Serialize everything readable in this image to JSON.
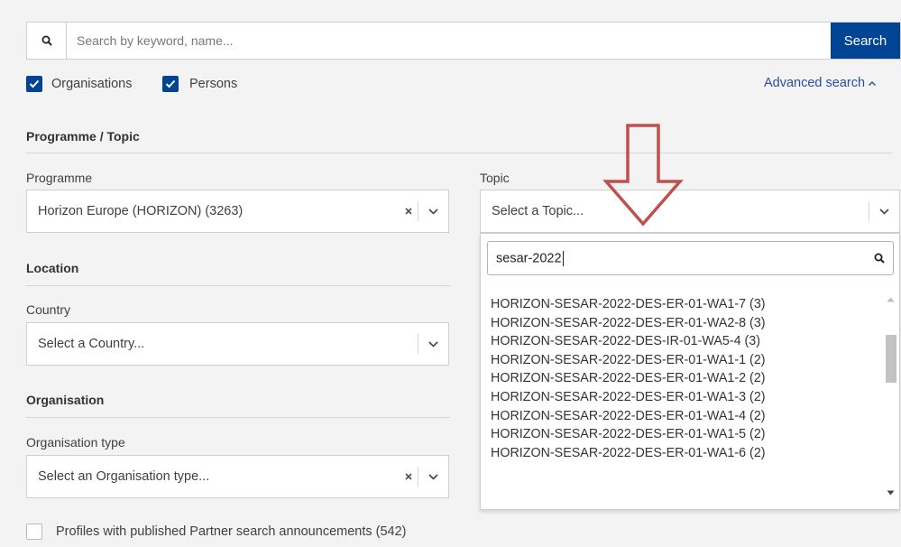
{
  "search": {
    "placeholder": "Search by keyword, name...",
    "button_label": "Search"
  },
  "filters": {
    "organisations_label": "Organisations",
    "persons_label": "Persons",
    "advanced_search_label": "Advanced search"
  },
  "programme_topic": {
    "section_title": "Programme / Topic",
    "programme_label": "Programme",
    "programme_value": "Horizon Europe (HORIZON) (3263)",
    "topic_label": "Topic",
    "topic_placeholder": "Select a Topic..."
  },
  "location": {
    "section_title": "Location",
    "country_label": "Country",
    "country_placeholder": "Select a Country..."
  },
  "organisation": {
    "section_title": "Organisation",
    "type_label": "Organisation type",
    "type_placeholder": "Select an Organisation type..."
  },
  "partner_checkbox_label": "Profiles with published Partner search announcements (542)",
  "topic_dropdown": {
    "search_value": "sesar-2022",
    "items": [
      "HORIZON-SESAR-2022-DES-ER-01-WA1-7 (3)",
      "HORIZON-SESAR-2022-DES-ER-01-WA2-8 (3)",
      "HORIZON-SESAR-2022-DES-IR-01-WA5-4 (3)",
      "HORIZON-SESAR-2022-DES-ER-01-WA1-1 (2)",
      "HORIZON-SESAR-2022-DES-ER-01-WA1-2 (2)",
      "HORIZON-SESAR-2022-DES-ER-01-WA1-3 (2)",
      "HORIZON-SESAR-2022-DES-ER-01-WA1-4 (2)",
      "HORIZON-SESAR-2022-DES-ER-01-WA1-5 (2)",
      "HORIZON-SESAR-2022-DES-ER-01-WA1-6 (2)"
    ]
  },
  "colors": {
    "primary": "#004494",
    "link": "#2a4f9c",
    "annotation_arrow": "#c0504d"
  },
  "icons": {
    "search": "search-icon",
    "clear": "clear-icon",
    "dropdown": "chevron-down-icon",
    "checked": "check-icon"
  }
}
